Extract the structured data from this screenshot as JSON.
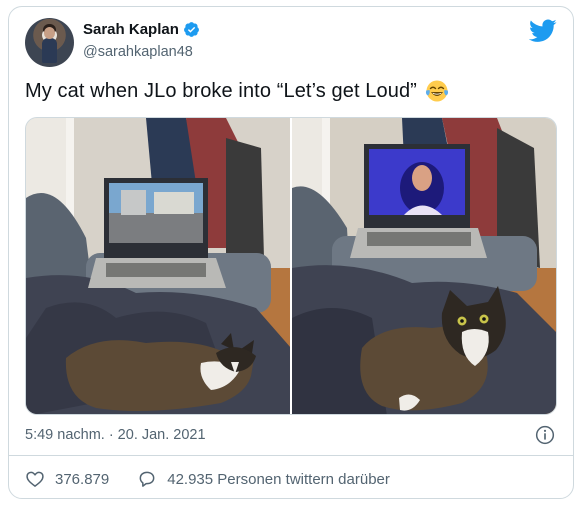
{
  "author": {
    "name": "Sarah Kaplan",
    "handle": "@sarahkaplan48",
    "verified": true
  },
  "tweet": {
    "text": "My cat when JLo broke into “Let’s get Loud”",
    "emoji": "face-with-tears-of-joy-icon"
  },
  "meta": {
    "timestamp": "5:49 nachm. · 20. Jan. 2021"
  },
  "actions": {
    "likes": "376.879",
    "retweets_label": "42.935 Personen twittern darüber"
  },
  "colors": {
    "brand": "#1d9bf0",
    "text": "#0f1419",
    "muted": "#536471",
    "border": "#cfd9de"
  }
}
